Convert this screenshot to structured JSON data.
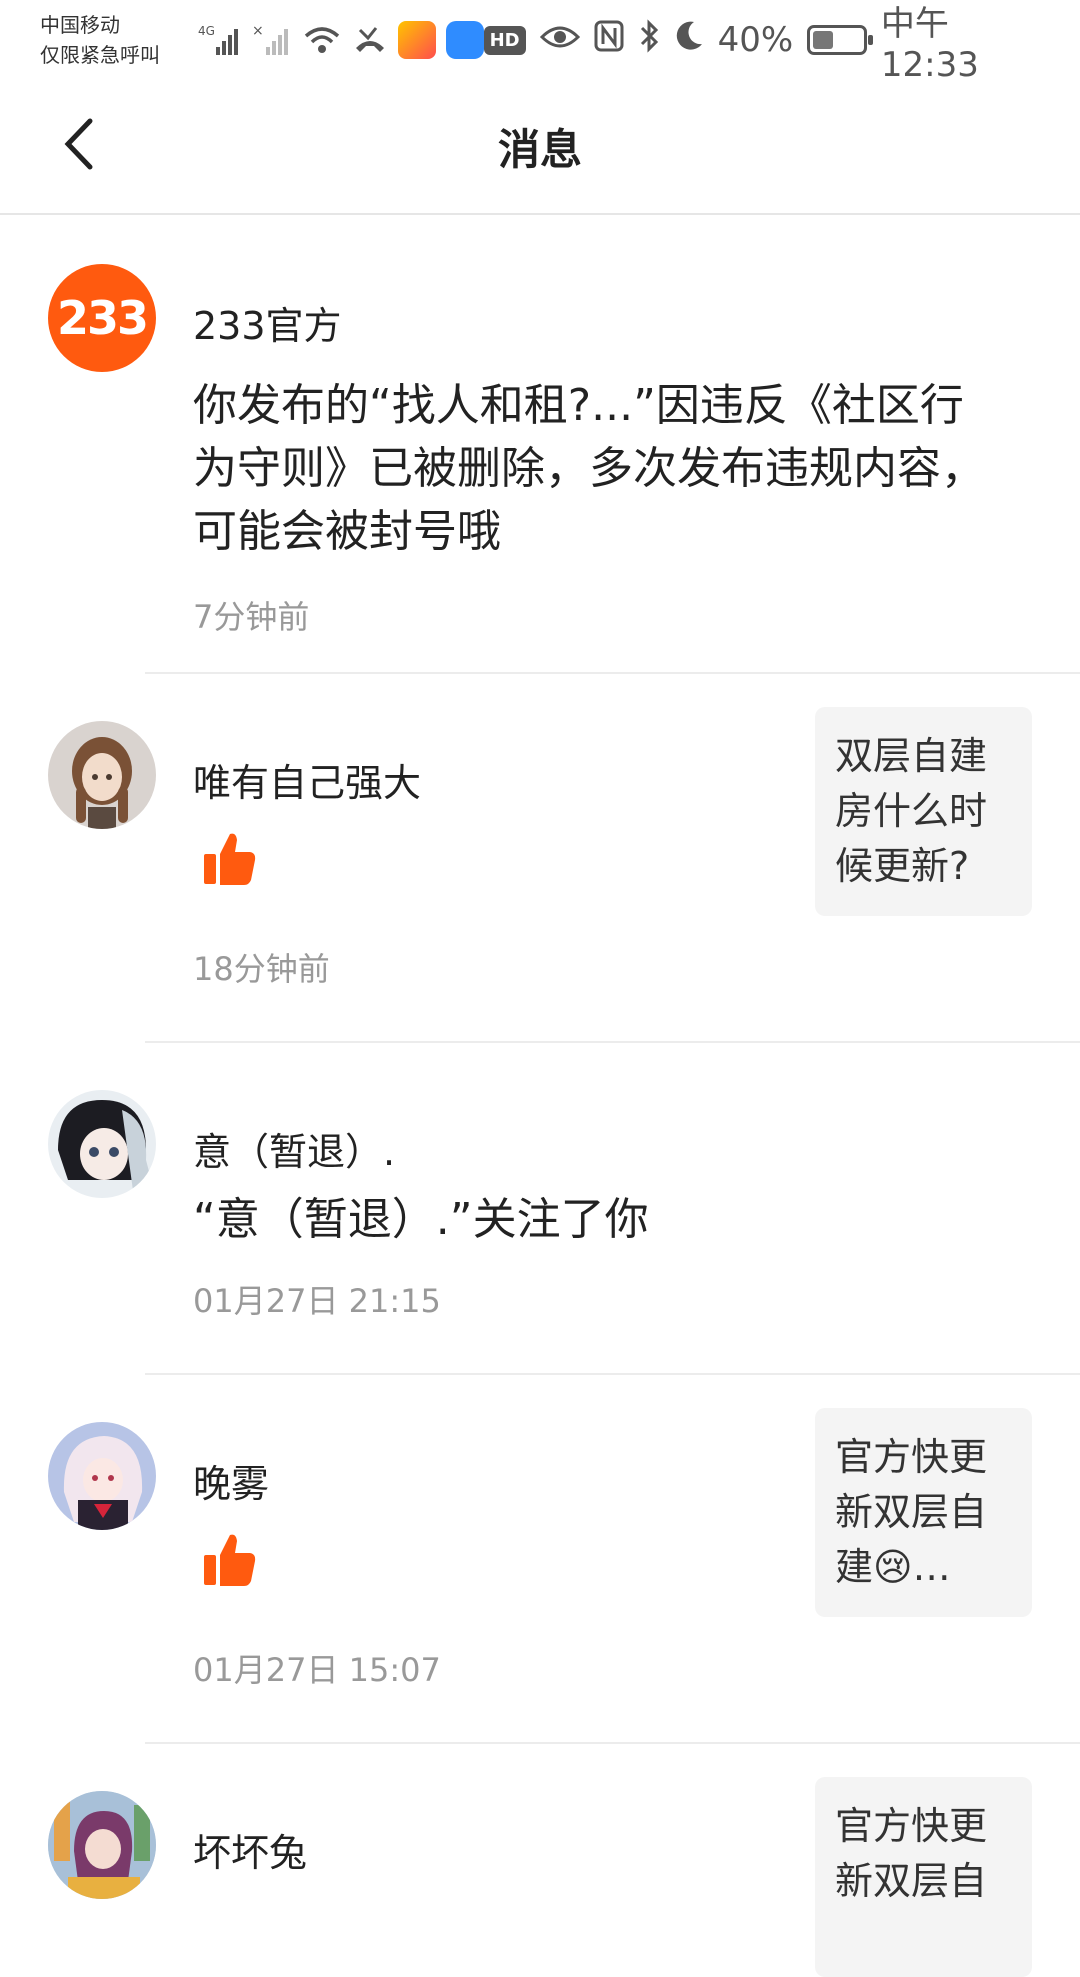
{
  "status_bar": {
    "carrier_line1": "中国移动",
    "carrier_line2": "仅限紧急呼叫",
    "network": "4G",
    "battery": "40%",
    "battery_level": 0.4,
    "time": "中午12:33",
    "hd": "HD"
  },
  "nav": {
    "title": "消息"
  },
  "messages": [
    {
      "name": "233官方",
      "avatar_text": "233",
      "text": "你发布的“找人和租?...”因违反《社区行为守则》已被删除，多次发布违规内容，可能会被封号哦",
      "time": "7分钟前"
    },
    {
      "name": "唯有自己强大",
      "quote": "双层自建房什么时候更新?",
      "time": "18分钟前"
    },
    {
      "name": "意（暂退）.",
      "text": "“意（暂退）.”关注了你",
      "time": "01月27日 21:15"
    },
    {
      "name": "晚雾",
      "quote": "官方快更新双层自建😢…",
      "time": "01月27日 15:07"
    },
    {
      "name": "坏坏兔",
      "quote": "官方快更新双层自"
    }
  ],
  "colors": {
    "accent": "#ff5a0f",
    "time_gray": "#999999"
  }
}
